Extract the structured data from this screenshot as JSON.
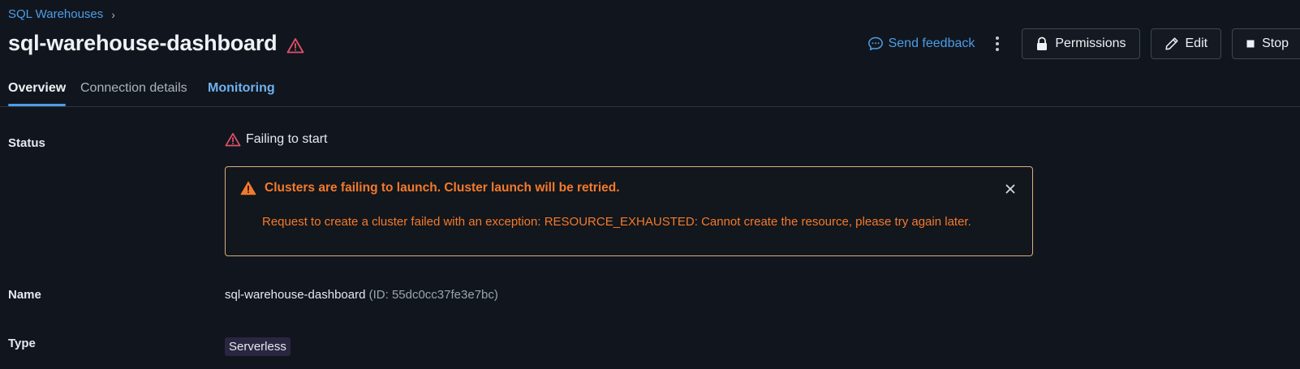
{
  "breadcrumb": {
    "parent": "SQL Warehouses",
    "separator": "›"
  },
  "header": {
    "title": "sql-warehouse-dashboard",
    "title_icon": "warning-triangle-icon"
  },
  "actions": {
    "feedback_label": "Send feedback",
    "permissions_label": "Permissions",
    "edit_label": "Edit",
    "stop_label": "Stop"
  },
  "tabs": [
    {
      "label": "Overview",
      "active": true
    },
    {
      "label": "Connection details",
      "active": false
    },
    {
      "label": "Monitoring",
      "active": false
    }
  ],
  "details": {
    "status": {
      "label": "Status",
      "value": "Failing to start"
    },
    "alert": {
      "title": "Clusters are failing to launch. Cluster launch will be retried.",
      "message": "Request to create a cluster failed with an exception: RESOURCE_EXHAUSTED: Cannot create the resource, please try again later."
    },
    "name": {
      "label": "Name",
      "value": "sql-warehouse-dashboard",
      "id_text": "(ID: 55dc0cc37fe3e7bc)"
    },
    "type": {
      "label": "Type",
      "value": "Serverless"
    }
  },
  "colors": {
    "background": "#11161e",
    "link": "#4d9de8",
    "warning": "#f47a2a",
    "status_warning": "#e0526b",
    "alert_border": "#d8b07a"
  }
}
